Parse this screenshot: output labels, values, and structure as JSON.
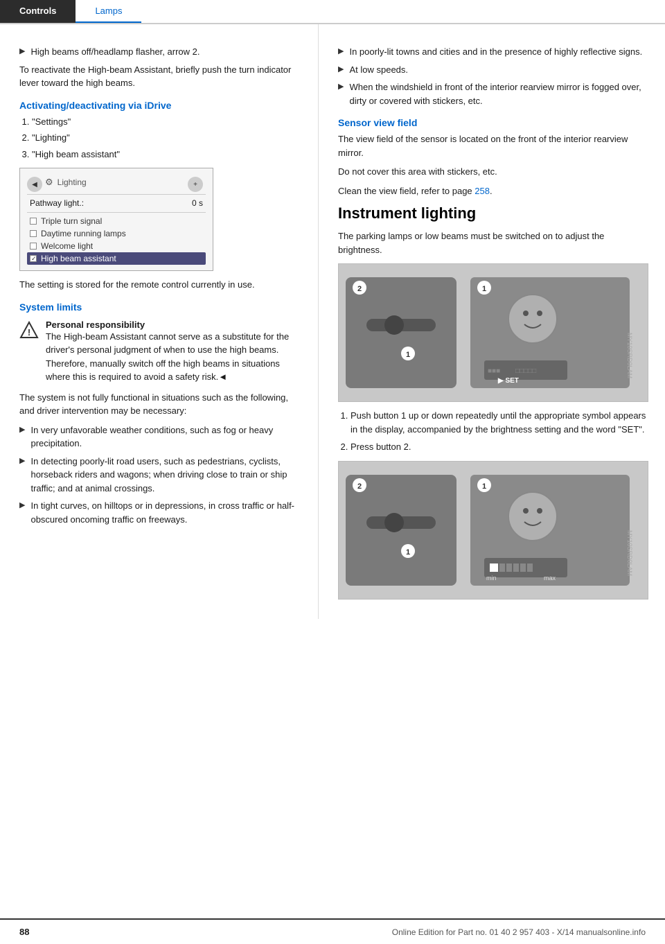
{
  "header": {
    "tab_controls": "Controls",
    "tab_lamps": "Lamps"
  },
  "left_col": {
    "bullet_high_beams": "High beams off/headlamp flasher, arrow 2.",
    "reactivate_text": "To reactivate the High-beam Assistant, briefly push the turn indicator lever toward the high beams.",
    "section1_heading": "Activating/deactivating via iDrive",
    "steps": [
      "\"Settings\"",
      "\"Lighting\"",
      "\"High beam assistant\""
    ],
    "idrive": {
      "title": "Lighting",
      "pathway_label": "Pathway light.:",
      "pathway_value": "0 s",
      "options": [
        {
          "label": "Triple turn signal",
          "checked": false
        },
        {
          "label": "Daytime running lamps",
          "checked": false
        },
        {
          "label": "Welcome light",
          "checked": false
        },
        {
          "label": "High beam assistant",
          "checked": true,
          "highlighted": true
        }
      ]
    },
    "setting_stored": "The setting is stored for the remote control currently in use.",
    "section2_heading": "System limits",
    "warning_title": "Personal responsibility",
    "warning_body": "The High-beam Assistant cannot serve as a substitute for the driver's personal judgment of when to use the high beams. Therefore, manually switch off the high beams in situations where this is required to avoid a safety risk.◄",
    "system_intro": "The system is not fully functional in situations such as the following, and driver intervention may be necessary:",
    "bullets": [
      "In very unfavorable weather conditions, such as fog or heavy precipitation.",
      "In detecting poorly-lit road users, such as pedestrians, cyclists, horseback riders and wagons; when driving close to train or ship traffic; and at animal crossings.",
      "In tight curves, on hilltops or in depressions, in cross traffic or half-obscured oncoming traffic on freeways."
    ]
  },
  "right_col": {
    "bullets_right": [
      "In poorly-lit towns and cities and in the presence of highly reflective signs.",
      "At low speeds.",
      "When the windshield in front of the interior rearview mirror is fogged over, dirty or covered with stickers, etc."
    ],
    "section_sensor": "Sensor view field",
    "sensor_text1": "The view field of the sensor is located on the front of the interior rearview mirror.",
    "sensor_text2": "Do not cover this area with stickers, etc.",
    "sensor_text3_pre": "Clean the view field, refer to page ",
    "sensor_page": "258",
    "sensor_text3_post": ".",
    "main_heading": "Instrument lighting",
    "instrument_intro": "The parking lamps or low beams must be switched on to adjust the brightness.",
    "step1": "Push button 1 up or down repeatedly until the appropriate symbol appears in the display, accompanied by the brightness setting and the word \"SET\".",
    "step2": "Press button 2.",
    "diagram1_label": "Instrument lighting diagram 1",
    "diagram2_label": "Instrument lighting diagram 2"
  },
  "footer": {
    "page_number": "88",
    "online_edition": "Online Edition for Part no. 01 40 2 957 403 - X/14",
    "website": "manualsonline.info"
  }
}
